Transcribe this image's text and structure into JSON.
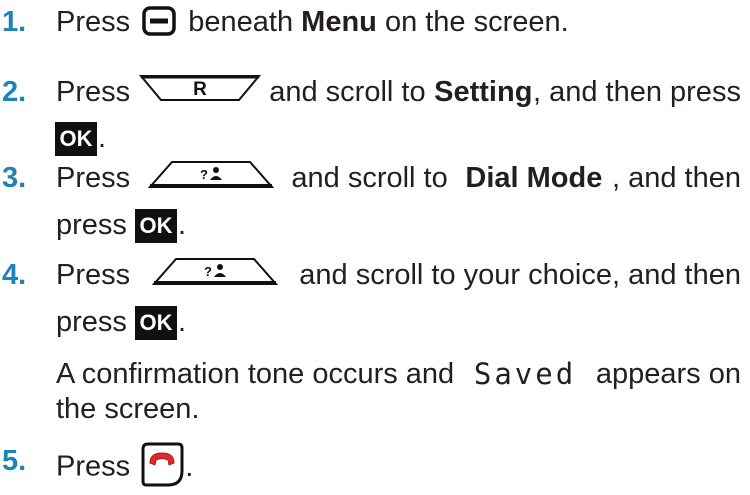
{
  "accent_color": "#1d84b5",
  "steps": [
    {
      "number": "1.",
      "press": "Press",
      "icon": "soft-key-icon",
      "text_a": "beneath",
      "bold": "Menu",
      "text_b": "on the screen."
    },
    {
      "number": "2.",
      "press": "Press",
      "icon": "r-key-icon",
      "icon_label": "R",
      "text_a": "and scroll to",
      "bold": "Setting",
      "text_b": ", and then press",
      "ok_label": "OK",
      "end": "."
    },
    {
      "number": "3.",
      "press": "Press",
      "icon": "directory-key-icon",
      "text_a": "and scroll to",
      "bold": "Dial Mode",
      "text_b": ", and then",
      "line2": "press",
      "ok_label": "OK",
      "end": "."
    },
    {
      "number": "4.",
      "press": "Press",
      "icon": "directory-key-icon",
      "text_a": "and scroll to your choice, and then",
      "line2": "press",
      "ok_label": "OK",
      "end": ".",
      "note_a": "A confirmation tone occurs and",
      "note_mono": "Saved",
      "note_b": "appears on",
      "note_line2": "the screen."
    },
    {
      "number": "5.",
      "press": "Press",
      "icon": "end-call-icon",
      "end": "."
    }
  ]
}
